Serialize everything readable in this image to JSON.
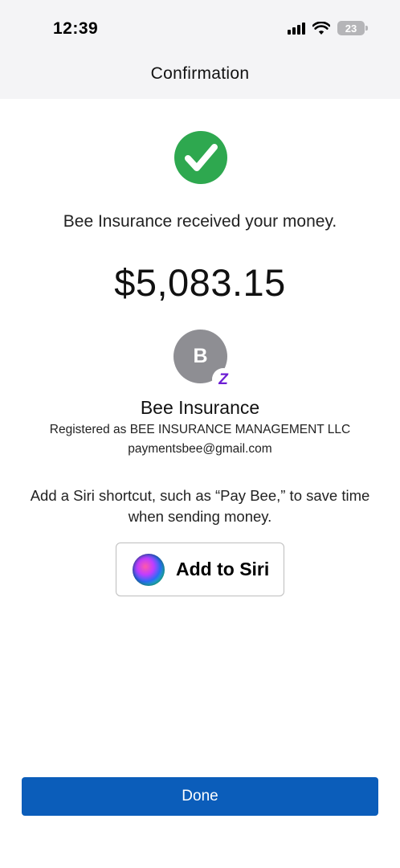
{
  "status_bar": {
    "time": "12:39",
    "battery": "23",
    "icons": [
      "signal-icon",
      "wifi-icon",
      "battery-icon"
    ]
  },
  "nav": {
    "title": "Confirmation"
  },
  "confirmation": {
    "icon": "checkmark-circle-icon",
    "accent_color": "#2ea84f",
    "message": "Bee Insurance received your money.",
    "amount": "$5,083.15"
  },
  "recipient": {
    "initial": "B",
    "name": "Bee Insurance",
    "registered": "Registered as BEE INSURANCE MANAGEMENT LLC",
    "email": "paymentsbee@gmail.com",
    "badge_icon": "zelle-icon",
    "badge_letter": "Z",
    "badge_color": "#6d1ed4"
  },
  "siri": {
    "prompt": "Add a Siri shortcut, such as “Pay Bee,” to save time when sending money.",
    "button_label": "Add to Siri",
    "icon": "siri-icon"
  },
  "footer": {
    "done_label": "Done",
    "button_color": "#0b5dba"
  }
}
